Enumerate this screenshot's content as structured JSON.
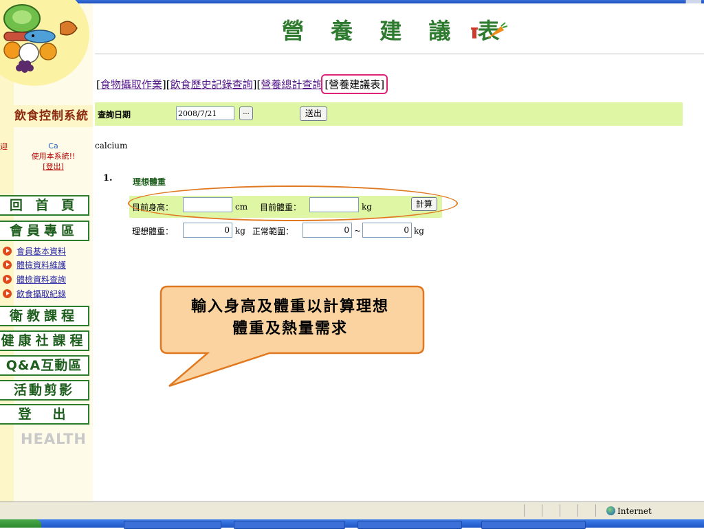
{
  "page": {
    "title": "營 養 建 議 表"
  },
  "sidebar": {
    "system_title": "飲食控制系統",
    "welcome_text": "迎",
    "user_name": "Ca",
    "user_message": "使用本系統!!",
    "logout_label": "[登出]",
    "nav": [
      {
        "label": "回 首 頁"
      },
      {
        "label": "會員專區"
      },
      {
        "label": "衛教課程"
      },
      {
        "label": "健康社課程"
      },
      {
        "label": "Q&A互動區"
      },
      {
        "label": "活動剪影"
      },
      {
        "label": "登　出"
      }
    ],
    "member_items": [
      {
        "label": "會員基本資料"
      },
      {
        "label": "體檢資料維護"
      },
      {
        "label": "體檢資料查詢"
      },
      {
        "label": "飲食攝取紀錄"
      }
    ],
    "health_text": "HEALTH"
  },
  "breadcrumb": {
    "open": "[",
    "sep": "][",
    "close": "]",
    "links": [
      {
        "label": "食物攝取作業"
      },
      {
        "label": "飲食歷史記錄查詢"
      },
      {
        "label": "營養總計查詢"
      }
    ],
    "current": "營養建議表"
  },
  "query": {
    "date_label": "查詢日期",
    "date_value": "2008/7/21",
    "picker_label": "...",
    "submit_label": "送出"
  },
  "nutrient_label": "calcium",
  "section": {
    "number": "1.",
    "title": "理想體重"
  },
  "calc": {
    "height_label": "目前身高：",
    "height_value": "",
    "height_unit": "cm",
    "weight_label": "目前體重：",
    "weight_value": "",
    "weight_unit": "kg",
    "calc_button": "計算"
  },
  "result": {
    "ideal_label": "理想體重：",
    "ideal_value": "0",
    "ideal_unit": "kg",
    "range_label": "正常範圍：",
    "range_min": "0",
    "range_sep": "~",
    "range_max": "0",
    "range_unit": "kg"
  },
  "callout": {
    "line1": "輸入身高及體重以計算理想",
    "line2": "體重及熱量需求"
  },
  "status": {
    "zone": "Internet"
  },
  "colors": {
    "accent_green": "#dff6a5",
    "title_green": "#2e7a2e",
    "highlight_pink": "#e0217a",
    "callout_fill": "#fbd3a0",
    "callout_border": "#e07820"
  }
}
